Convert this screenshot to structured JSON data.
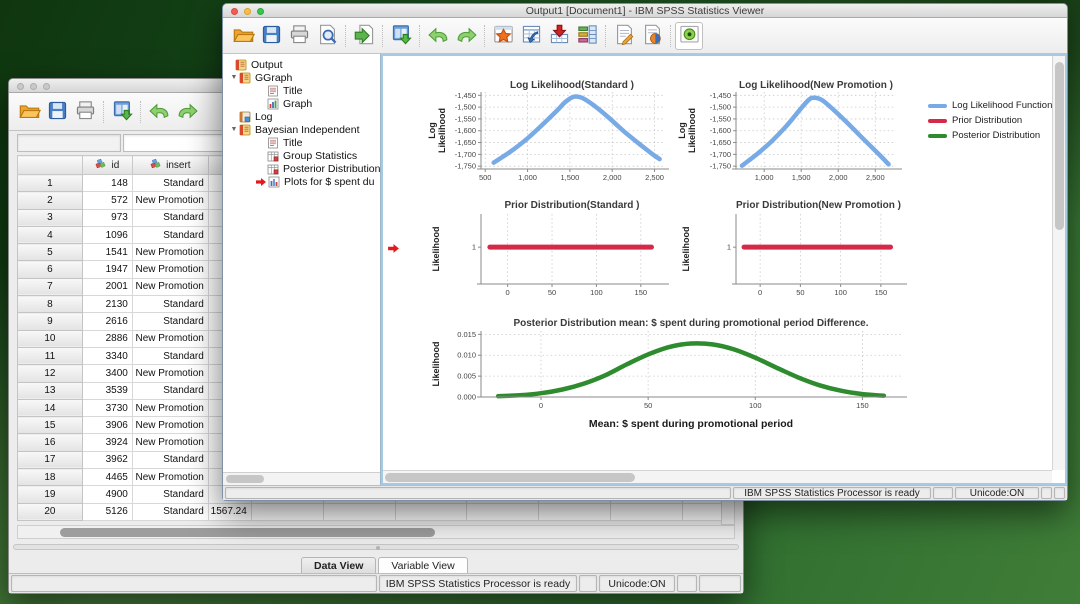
{
  "viewer_window": {
    "title": "Output1 [Document1] - IBM SPSS Statistics Viewer",
    "toolbar": {
      "groups": [
        [
          "open",
          "save",
          "print",
          "print-preview"
        ],
        [
          "export"
        ],
        [
          "recall-dialogs"
        ],
        [
          "undo",
          "redo"
        ],
        [
          "designate-window",
          "goto-data",
          "goto-case",
          "variables"
        ],
        [
          "edit-text",
          "run-script"
        ],
        [
          "select-last-output"
        ]
      ]
    },
    "tree": {
      "items": [
        {
          "label": "Output",
          "icon": "book",
          "level": 0
        },
        {
          "label": "GGraph",
          "icon": "book",
          "level": 1,
          "expanded": true
        },
        {
          "label": "Title",
          "icon": "doc",
          "level": 2
        },
        {
          "label": "Graph",
          "icon": "chart",
          "level": 2
        },
        {
          "label": "Log",
          "icon": "log",
          "level": 1
        },
        {
          "label": "Bayesian Independent",
          "icon": "book",
          "level": 1,
          "expanded": true
        },
        {
          "label": "Title",
          "icon": "doc",
          "level": 2
        },
        {
          "label": "Group Statistics",
          "icon": "table",
          "level": 2
        },
        {
          "label": "Posterior Distribution",
          "icon": "table",
          "level": 2
        },
        {
          "label": "Plots for $ spent du",
          "icon": "chart2",
          "level": 2,
          "marker": true
        }
      ]
    },
    "status": {
      "processor": "IBM SPSS Statistics Processor is ready",
      "unicode": "Unicode:ON"
    }
  },
  "data_window": {
    "toolbar": {
      "groups": [
        [
          "open",
          "save",
          "print"
        ],
        [
          "recall-dialogs"
        ],
        [
          "undo",
          "redo"
        ]
      ]
    },
    "table": {
      "columns": [
        {
          "label": "",
          "icon": null
        },
        {
          "label": "id",
          "icon": "nominal"
        },
        {
          "label": "insert",
          "icon": "nominal"
        },
        {
          "label": "",
          "icon": "scale"
        }
      ],
      "rows": [
        {
          "n": "1",
          "id": "148",
          "insert": "Standard",
          "spent": ""
        },
        {
          "n": "2",
          "id": "572",
          "insert": "New Promotion",
          "spent": ""
        },
        {
          "n": "3",
          "id": "973",
          "insert": "Standard",
          "spent": ""
        },
        {
          "n": "4",
          "id": "1096",
          "insert": "Standard",
          "spent": ""
        },
        {
          "n": "5",
          "id": "1541",
          "insert": "New Promotion",
          "spent": ""
        },
        {
          "n": "6",
          "id": "1947",
          "insert": "New Promotion",
          "spent": ""
        },
        {
          "n": "7",
          "id": "2001",
          "insert": "New Promotion",
          "spent": ""
        },
        {
          "n": "8",
          "id": "2130",
          "insert": "Standard",
          "spent": ""
        },
        {
          "n": "9",
          "id": "2616",
          "insert": "Standard",
          "spent": ""
        },
        {
          "n": "10",
          "id": "2886",
          "insert": "New Promotion",
          "spent": ""
        },
        {
          "n": "11",
          "id": "3340",
          "insert": "Standard",
          "spent": ""
        },
        {
          "n": "12",
          "id": "3400",
          "insert": "New Promotion",
          "spent": ""
        },
        {
          "n": "13",
          "id": "3539",
          "insert": "Standard",
          "spent": ""
        },
        {
          "n": "14",
          "id": "3730",
          "insert": "New Promotion",
          "spent": ""
        },
        {
          "n": "15",
          "id": "3906",
          "insert": "New Promotion",
          "spent": ""
        },
        {
          "n": "16",
          "id": "3924",
          "insert": "New Promotion",
          "spent": ""
        },
        {
          "n": "17",
          "id": "3962",
          "insert": "Standard",
          "spent": ""
        },
        {
          "n": "18",
          "id": "4465",
          "insert": "New Promotion",
          "spent": ""
        },
        {
          "n": "19",
          "id": "4900",
          "insert": "Standard",
          "spent": ""
        },
        {
          "n": "20",
          "id": "5126",
          "insert": "Standard",
          "spent": "1567.24"
        }
      ]
    },
    "tabs": [
      {
        "label": "Data View",
        "active": true
      },
      {
        "label": "Variable View",
        "active": false
      }
    ],
    "status": {
      "processor": "IBM SPSS Statistics Processor is ready",
      "unicode": "Unicode:ON"
    }
  },
  "legend": {
    "entries": [
      {
        "label": "Log Likelihood Function",
        "color": "#78aae6"
      },
      {
        "label": "Prior Distribution",
        "color": "#d42a47"
      },
      {
        "label": "Posterior Distribution",
        "color": "#2e8b2e"
      }
    ]
  },
  "chart_data": [
    {
      "type": "line",
      "title": "Log Likelihood(Standard )",
      "ylabel": "Log Likelihood",
      "color": "#78aae6",
      "xlim": [
        450,
        2600
      ],
      "ylim": [
        -1762,
        -1436
      ],
      "xticks": [
        500,
        1000,
        1500,
        2000,
        2500
      ],
      "xtick_labels": [
        "500",
        "1,000",
        "1,500",
        "2,000",
        "2,500"
      ],
      "yticks": [
        -1450,
        -1500,
        -1550,
        -1600,
        -1650,
        -1700,
        -1750
      ],
      "ytick_labels": [
        "-1,450",
        "-1,500",
        "-1,550",
        "-1,600",
        "-1,650",
        "-1,700",
        "-1,750"
      ],
      "points": [
        [
          600,
          -1735
        ],
        [
          800,
          -1688
        ],
        [
          1000,
          -1632
        ],
        [
          1200,
          -1566
        ],
        [
          1350,
          -1514
        ],
        [
          1450,
          -1477
        ],
        [
          1550,
          -1456
        ],
        [
          1650,
          -1462
        ],
        [
          1780,
          -1492
        ],
        [
          1950,
          -1542
        ],
        [
          2150,
          -1606
        ],
        [
          2350,
          -1664
        ],
        [
          2480,
          -1700
        ],
        [
          2560,
          -1720
        ]
      ]
    },
    {
      "type": "line",
      "title": "Log Likelihood(New Promotion )",
      "ylabel": "Log Likelihood",
      "color": "#78aae6",
      "xlim": [
        620,
        2780
      ],
      "ylim": [
        -1762,
        -1436
      ],
      "xticks": [
        1000,
        1500,
        2000,
        2500
      ],
      "xtick_labels": [
        "1,000",
        "1,500",
        "2,000",
        "2,500"
      ],
      "yticks": [
        -1450,
        -1500,
        -1550,
        -1600,
        -1650,
        -1700,
        -1750
      ],
      "ytick_labels": [
        "-1,450",
        "-1,500",
        "-1,550",
        "-1,600",
        "-1,650",
        "-1,700",
        "-1,750"
      ],
      "points": [
        [
          700,
          -1748
        ],
        [
          900,
          -1700
        ],
        [
          1100,
          -1645
        ],
        [
          1300,
          -1580
        ],
        [
          1480,
          -1512
        ],
        [
          1600,
          -1470
        ],
        [
          1670,
          -1460
        ],
        [
          1780,
          -1470
        ],
        [
          1950,
          -1515
        ],
        [
          2150,
          -1575
        ],
        [
          2350,
          -1638
        ],
        [
          2550,
          -1700
        ],
        [
          2680,
          -1742
        ]
      ]
    },
    {
      "type": "line",
      "title": "Prior Distribution(Standard )",
      "ylabel": "Likelihood",
      "color": "#d42a47",
      "xlim": [
        -30,
        175
      ],
      "ylim": [
        0,
        1.9
      ],
      "xticks": [
        0,
        50,
        100,
        150
      ],
      "xtick_labels": [
        "0",
        "50",
        "100",
        "150"
      ],
      "yticks": [
        1
      ],
      "ytick_labels": [
        "1"
      ],
      "points": [
        [
          -20,
          1
        ],
        [
          162,
          1
        ]
      ]
    },
    {
      "type": "line",
      "title": "Prior Distribution(New Promotion )",
      "ylabel": "Likelihood",
      "color": "#d42a47",
      "xlim": [
        -30,
        175
      ],
      "ylim": [
        0,
        1.9
      ],
      "xticks": [
        0,
        50,
        100,
        150
      ],
      "xtick_labels": [
        "0",
        "50",
        "100",
        "150"
      ],
      "yticks": [
        1
      ],
      "ytick_labels": [
        "1"
      ],
      "points": [
        [
          -20,
          1
        ],
        [
          162,
          1
        ]
      ]
    },
    {
      "type": "line",
      "title": "Posterior Distribution mean: $ spent during promotional period Difference.",
      "ylabel": "Likelihood",
      "xlabel": "Mean: $ spent during promotional period",
      "color": "#2e8b2e",
      "xlim": [
        -28,
        168
      ],
      "ylim": [
        0,
        0.0158
      ],
      "xticks": [
        0,
        50,
        100,
        150
      ],
      "xtick_labels": [
        "0",
        "50",
        "100",
        "150"
      ],
      "yticks": [
        0,
        0.005,
        0.01,
        0.015
      ],
      "ytick_labels": [
        "0.000",
        "0.005",
        "0.010",
        "0.015"
      ],
      "points": [
        [
          -20,
          0.0002
        ],
        [
          -10,
          0.0004
        ],
        [
          0,
          0.0009
        ],
        [
          10,
          0.0018
        ],
        [
          20,
          0.0032
        ],
        [
          30,
          0.0052
        ],
        [
          40,
          0.0078
        ],
        [
          50,
          0.0102
        ],
        [
          60,
          0.012
        ],
        [
          70,
          0.0128
        ],
        [
          80,
          0.0126
        ],
        [
          90,
          0.0114
        ],
        [
          100,
          0.0094
        ],
        [
          110,
          0.007
        ],
        [
          120,
          0.0047
        ],
        [
          130,
          0.0028
        ],
        [
          140,
          0.0015
        ],
        [
          150,
          0.0007
        ],
        [
          160,
          0.0003
        ]
      ]
    }
  ],
  "ui_colors": {
    "content_focus_border": "#a6c9e4",
    "desktop_green": "#2f6e2f"
  }
}
